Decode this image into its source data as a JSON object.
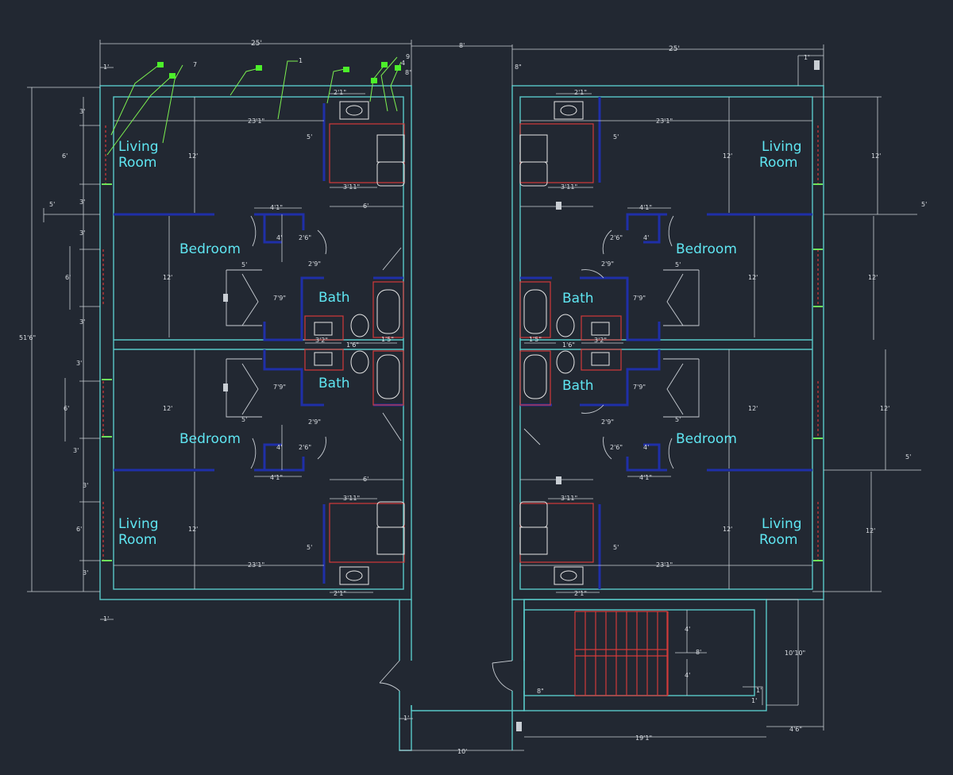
{
  "rooms": {
    "living_tl": [
      "Living",
      "Room"
    ],
    "living_bl": [
      "Living",
      "Room"
    ],
    "living_tr": [
      "Living",
      "Room"
    ],
    "living_br": [
      "Living",
      "Room"
    ],
    "bedroom": "Bedroom",
    "bath": "Bath"
  },
  "dims": {
    "overall_width": "25'",
    "corridor_width": "8'",
    "overall_height": "51'6\"",
    "living_width": "23'1\"",
    "living_depth": "12'",
    "bedroom_depth": "12'",
    "window": "6'",
    "wall_3": "3'",
    "one_ft": "1'",
    "kitchen_w": "2'1\"",
    "kitchen_3_11": "3'11\"",
    "kitchen_6": "6'",
    "kitchen_5": "5'",
    "closet_4_1": "4'1\"",
    "closet_4": "4'",
    "closet_2_6": "2'6\"",
    "closet_2_9": "2'9\"",
    "closet_7_9": "7'9\"",
    "closet_5": "5'",
    "bath_3_2": "3'2\"",
    "bath_1_6": "1'6\"",
    "bath_1_5": "1'5\"",
    "stair_4": "4'",
    "stair_8": "8'",
    "stair_total": "10'10\"",
    "bottom_19": "19'1\"",
    "bottom_10": "10'",
    "bottom_4_6": "4'6\"",
    "leader_1": "1",
    "leader_7": "7",
    "leader_9": "9",
    "leader_4": "4",
    "eight_in": "8\""
  }
}
